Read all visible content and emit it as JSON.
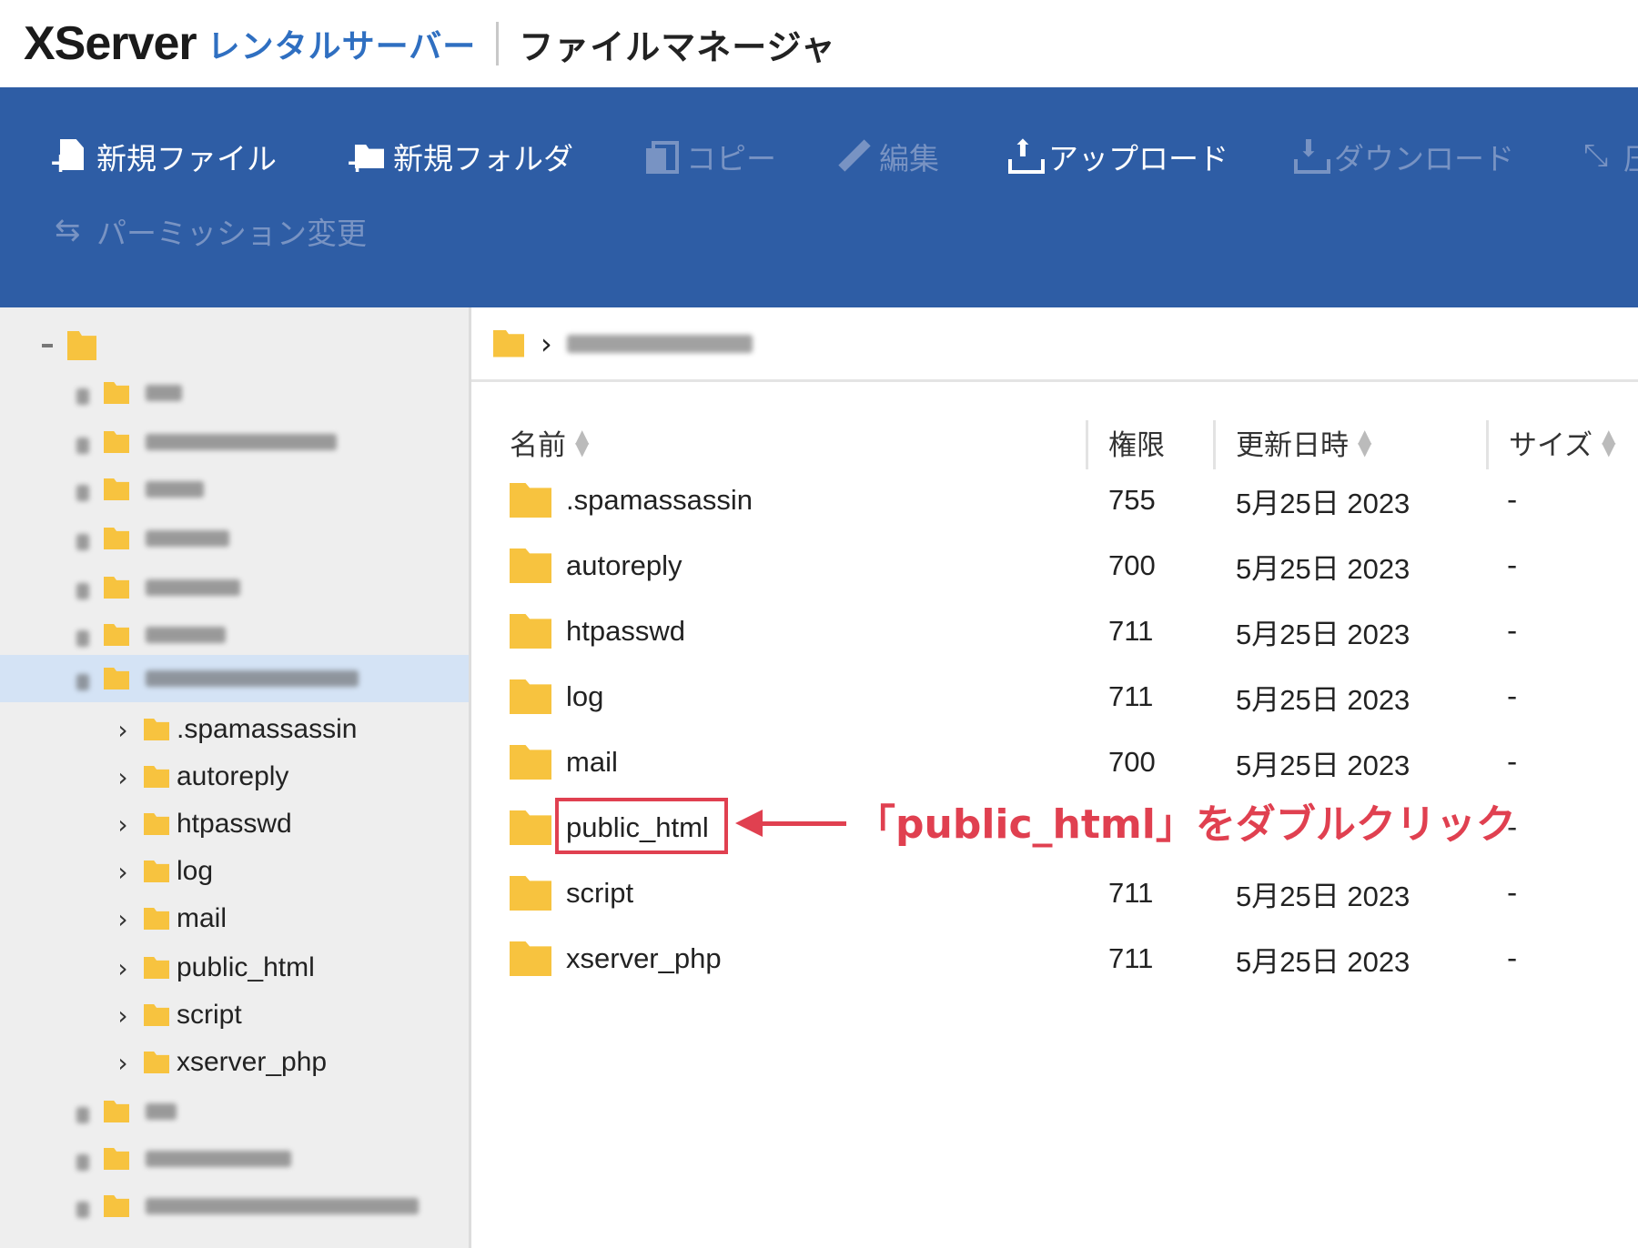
{
  "header": {
    "logo_brand": "XServer",
    "logo_sub": "レンタルサーバー",
    "app_title": "ファイルマネージャ"
  },
  "toolbar": {
    "items": [
      {
        "label": "新規ファイル",
        "icon": "new-file-icon",
        "enabled": true
      },
      {
        "label": "新規フォルダ",
        "icon": "new-folder-icon",
        "enabled": true
      },
      {
        "label": "コピー",
        "icon": "copy-icon",
        "enabled": false
      },
      {
        "label": "編集",
        "icon": "pencil-icon",
        "enabled": false
      },
      {
        "label": "アップロード",
        "icon": "upload-icon",
        "enabled": true
      },
      {
        "label": "ダウンロード",
        "icon": "download-icon",
        "enabled": false
      },
      {
        "label": "圧",
        "icon": "compress-icon",
        "enabled": false
      },
      {
        "label": "パーミッション変更",
        "icon": "permission-icon",
        "enabled": false
      }
    ]
  },
  "sidebar": {
    "children": [
      ".spamassassin",
      "autoreply",
      "htpasswd",
      "log",
      "mail",
      "public_html",
      "script",
      "xserver_php"
    ]
  },
  "table": {
    "headers": {
      "name": "名前",
      "perm": "権限",
      "date": "更新日時",
      "size": "サイズ"
    },
    "rows": [
      {
        "name": ".spamassassin",
        "perm": "755",
        "date": "5月25日 2023",
        "size": "-"
      },
      {
        "name": "autoreply",
        "perm": "700",
        "date": "5月25日 2023",
        "size": "-"
      },
      {
        "name": "htpasswd",
        "perm": "711",
        "date": "5月25日 2023",
        "size": "-"
      },
      {
        "name": "log",
        "perm": "711",
        "date": "5月25日 2023",
        "size": "-"
      },
      {
        "name": "mail",
        "perm": "700",
        "date": "5月25日 2023",
        "size": "-"
      },
      {
        "name": "public_html",
        "perm": "",
        "date": "",
        "size": "-"
      },
      {
        "name": "script",
        "perm": "711",
        "date": "5月25日 2023",
        "size": "-"
      },
      {
        "name": "xserver_php",
        "perm": "711",
        "date": "5月25日 2023",
        "size": "-"
      }
    ]
  },
  "annotation": {
    "text": "「public_html」をダブルクリック",
    "color": "#e04050"
  },
  "colors": {
    "toolbar_bg": "#2e5da5",
    "folder": "#f7c33f",
    "brand_blue": "#2f6fc1"
  }
}
